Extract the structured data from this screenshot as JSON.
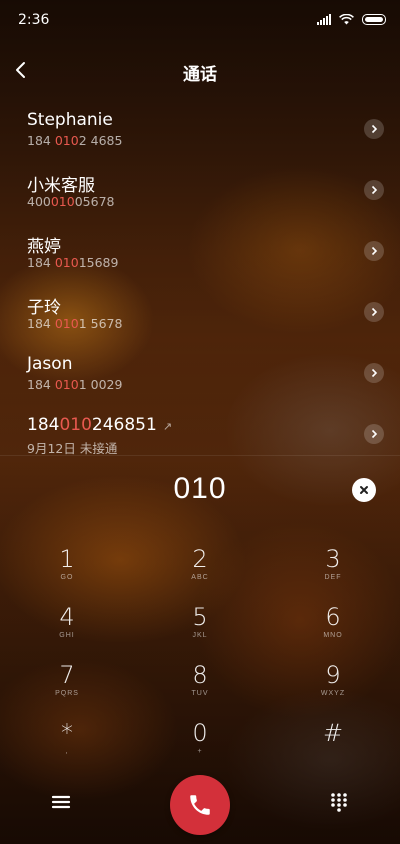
{
  "status": {
    "time": "2:36"
  },
  "header": {
    "title": "通话"
  },
  "contacts": [
    {
      "name": "Stephanie",
      "num_pre": "184 ",
      "num_hl": "010",
      "num_post": "2 4685",
      "missed": ""
    },
    {
      "name": "小米客服",
      "num_pre": "400",
      "num_hl": "010",
      "num_post": "05678",
      "missed": ""
    },
    {
      "name": "燕婷",
      "num_pre": "184 ",
      "num_hl": "010",
      "num_post": "15689",
      "missed": ""
    },
    {
      "name": "子玲",
      "num_pre": "184 ",
      "num_hl": "010",
      "num_post": "1 5678",
      "missed": ""
    },
    {
      "name": "Jason",
      "num_pre": "184 ",
      "num_hl": "010",
      "num_post": "1 0029",
      "missed": ""
    },
    {
      "name_pre": "184",
      "name_hl": "010",
      "name_post": "246851",
      "missed": "↗",
      "sub": "9月12日 未接通"
    }
  ],
  "dial": {
    "number": "010"
  },
  "keys": [
    {
      "digit": "1",
      "letters": "GO"
    },
    {
      "digit": "2",
      "letters": "ABC"
    },
    {
      "digit": "3",
      "letters": "DEF"
    },
    {
      "digit": "4",
      "letters": "GHI"
    },
    {
      "digit": "5",
      "letters": "JKL"
    },
    {
      "digit": "6",
      "letters": "MNO"
    },
    {
      "digit": "7",
      "letters": "PQRS"
    },
    {
      "digit": "8",
      "letters": "TUV"
    },
    {
      "digit": "9",
      "letters": "WXYZ"
    },
    {
      "digit": "*",
      "letters": ","
    },
    {
      "digit": "0",
      "letters": "+"
    },
    {
      "digit": "#",
      "letters": ""
    }
  ],
  "colors": {
    "accent_red": "#e8594f",
    "call_button": "#d3303a"
  },
  "icons": {
    "back": "chevron-left-icon",
    "detail": "chevron-right-icon",
    "clear": "close-icon",
    "menu": "menu-icon",
    "call": "phone-icon",
    "keypad": "dialpad-icon"
  }
}
